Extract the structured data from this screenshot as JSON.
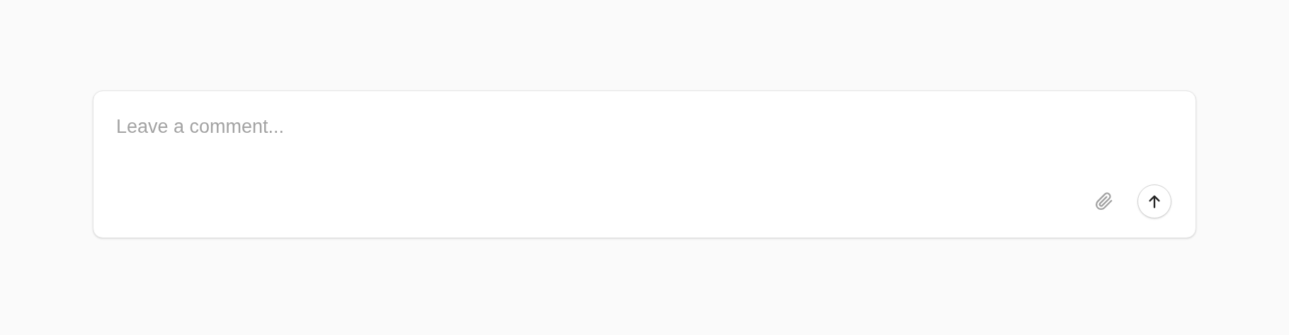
{
  "comment_box": {
    "placeholder": "Leave a comment..."
  }
}
